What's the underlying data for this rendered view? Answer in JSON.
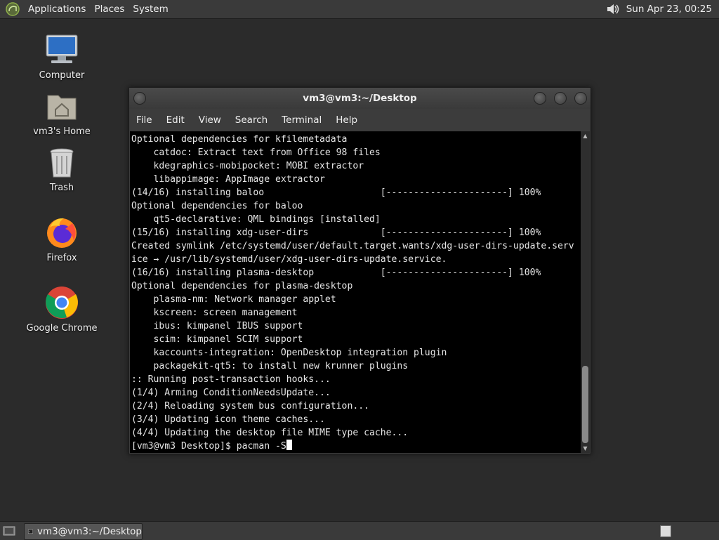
{
  "top_panel": {
    "menus": [
      "Applications",
      "Places",
      "System"
    ],
    "clock": "Sun Apr 23, 00:25"
  },
  "desktop_icons": [
    {
      "label": "Computer",
      "icon": "computer-icon"
    },
    {
      "label": "vm3's Home",
      "icon": "home-folder-icon"
    },
    {
      "label": "Trash",
      "icon": "trash-icon"
    },
    {
      "label": "Firefox",
      "icon": "firefox-icon"
    },
    {
      "label": "Google Chrome",
      "icon": "chrome-icon"
    }
  ],
  "terminal": {
    "title": "vm3@vm3:~/Desktop",
    "menu": [
      "File",
      "Edit",
      "View",
      "Search",
      "Terminal",
      "Help"
    ],
    "lines": [
      "Optional dependencies for kfilemetadata",
      "    catdoc: Extract text from Office 98 files",
      "    kdegraphics-mobipocket: MOBI extractor",
      "    libappimage: AppImage extractor",
      "(14/16) installing baloo                     [----------------------] 100%",
      "Optional dependencies for baloo",
      "    qt5-declarative: QML bindings [installed]",
      "(15/16) installing xdg-user-dirs             [----------------------] 100%",
      "Created symlink /etc/systemd/user/default.target.wants/xdg-user-dirs-update.serv",
      "ice → /usr/lib/systemd/user/xdg-user-dirs-update.service.",
      "(16/16) installing plasma-desktop            [----------------------] 100%",
      "Optional dependencies for plasma-desktop",
      "    plasma-nm: Network manager applet",
      "    kscreen: screen management",
      "    ibus: kimpanel IBUS support",
      "    scim: kimpanel SCIM support",
      "    kaccounts-integration: OpenDesktop integration plugin",
      "    packagekit-qt5: to install new krunner plugins",
      ":: Running post-transaction hooks...",
      "(1/4) Arming ConditionNeedsUpdate...",
      "(2/4) Reloading system bus configuration...",
      "(3/4) Updating icon theme caches...",
      "(4/4) Updating the desktop file MIME type cache..."
    ],
    "prompt": "[vm3@vm3 Desktop]$ ",
    "input": "pacman -S"
  },
  "taskbar": {
    "task_label": "vm3@vm3:~/Desktop"
  }
}
